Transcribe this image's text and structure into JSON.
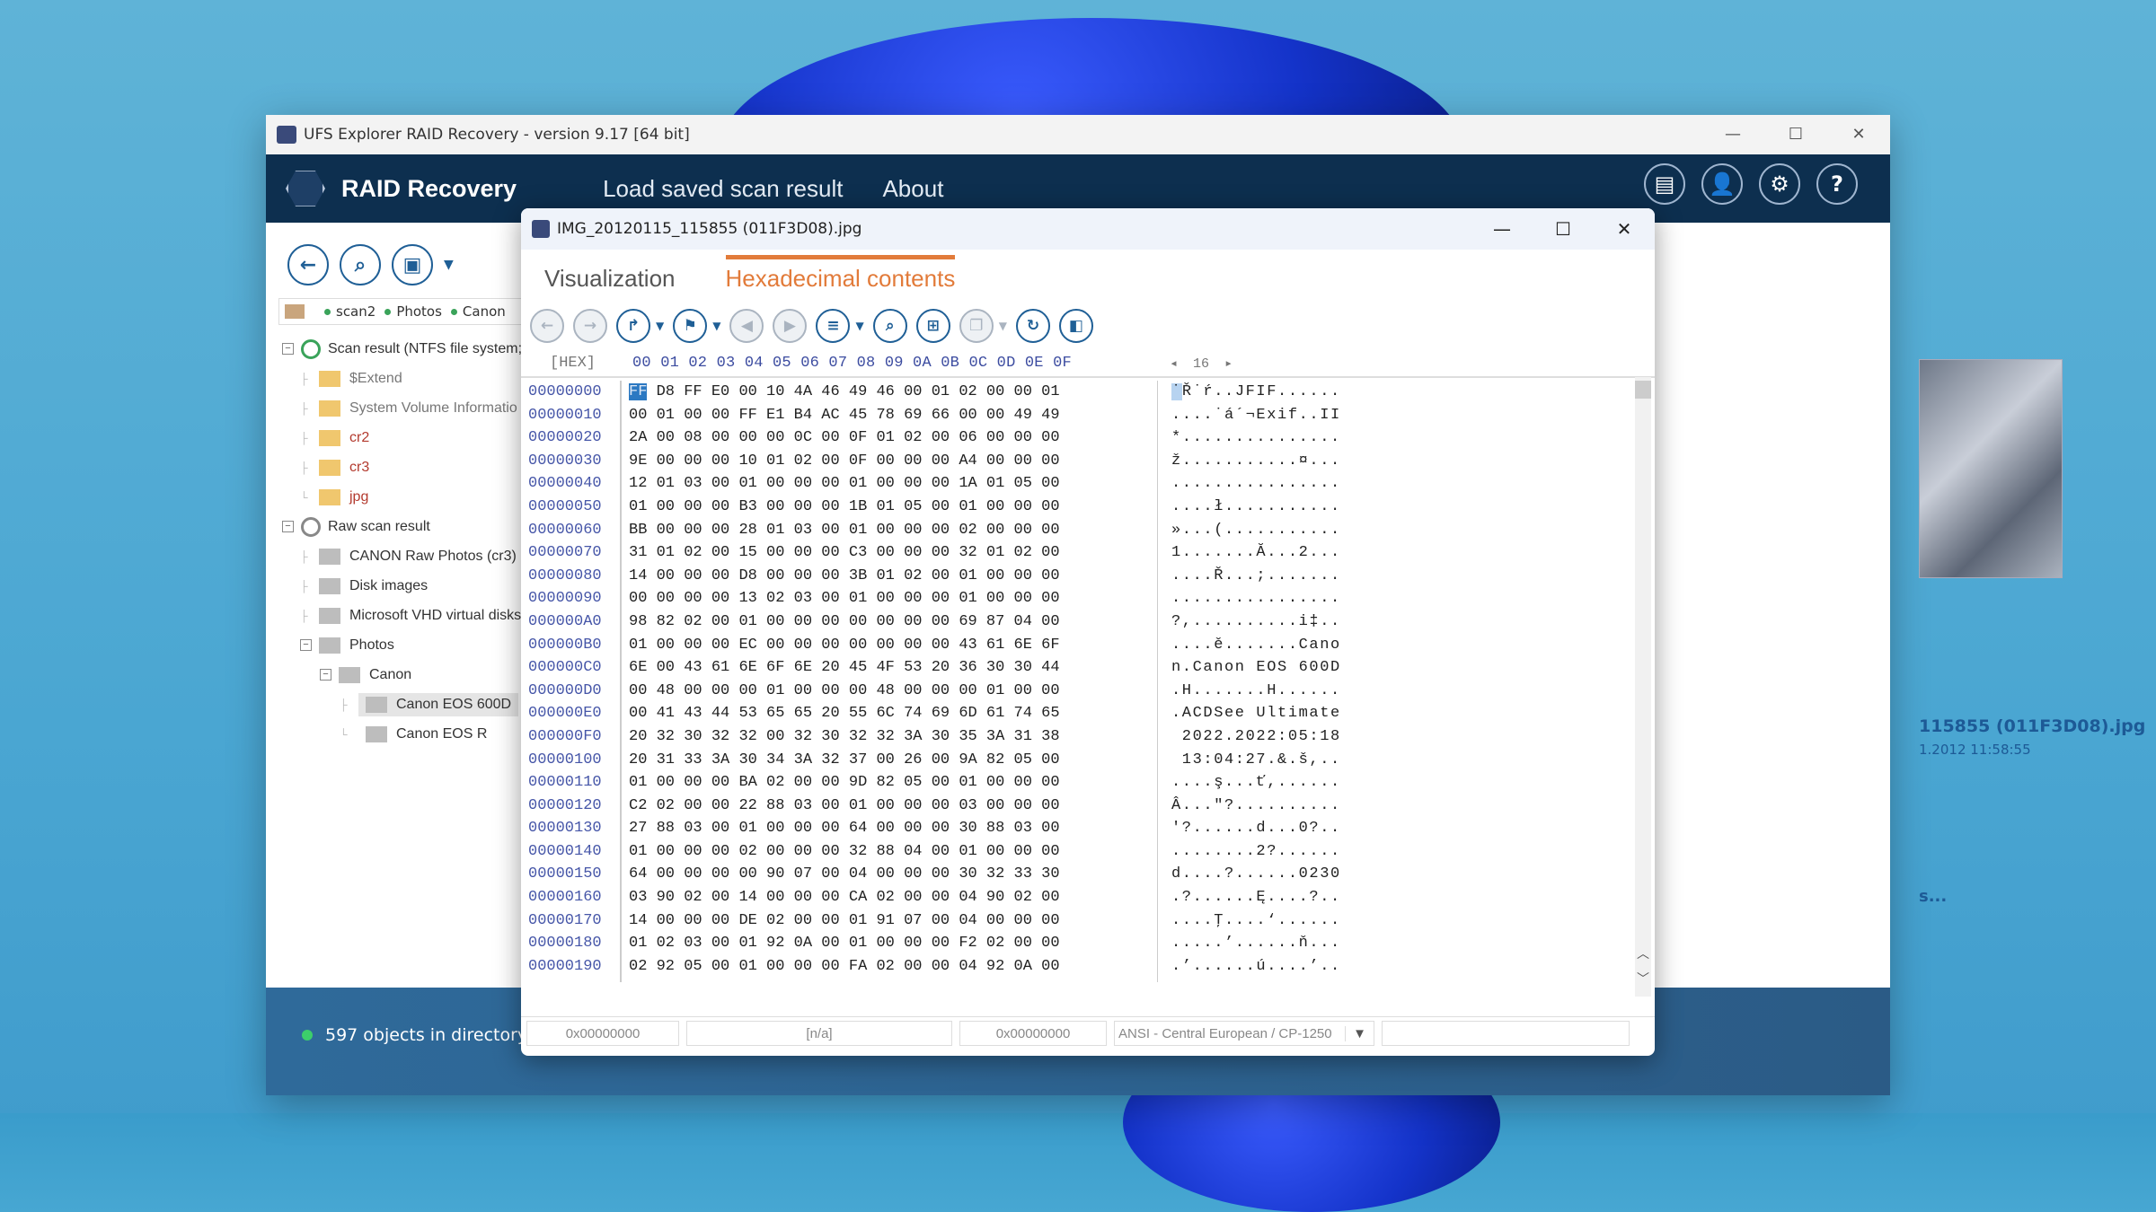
{
  "window": {
    "title": "UFS Explorer RAID Recovery - version 9.17 [64 bit]",
    "controls": {
      "minimize": "—",
      "maximize": "☐",
      "close": "✕"
    }
  },
  "appbar": {
    "brand": "RAID Recovery",
    "menu": [
      "Load saved scan result",
      "About"
    ],
    "icons": [
      {
        "name": "log-icon",
        "glyph": "▤"
      },
      {
        "name": "user-icon",
        "glyph": "👤"
      },
      {
        "name": "gear-icon",
        "glyph": "⚙"
      },
      {
        "name": "help-icon",
        "glyph": "?"
      }
    ]
  },
  "left_toolbar": {
    "icons": [
      {
        "name": "back-icon",
        "glyph": "←"
      },
      {
        "name": "search-icon",
        "glyph": "⌕"
      },
      {
        "name": "save-icon",
        "glyph": "▣"
      }
    ],
    "dropdown": "▼"
  },
  "breadcrumb": [
    "scan2",
    "Photos",
    "Canon"
  ],
  "tree": {
    "scan_result": "Scan result (NTFS file system;",
    "scan_children": [
      {
        "label": "$Extend",
        "style": "gray"
      },
      {
        "label": "System Volume Informatio",
        "style": "gray"
      },
      {
        "label": "cr2",
        "style": "red"
      },
      {
        "label": "cr3",
        "style": "red"
      },
      {
        "label": "jpg",
        "style": "red"
      }
    ],
    "raw_result": "Raw scan result",
    "raw_children": [
      "CANON Raw Photos (cr3)",
      "Disk images",
      "Microsoft VHD virtual disks"
    ],
    "photos": "Photos",
    "canon": "Canon",
    "canon_children": [
      "Canon EOS 600D",
      "Canon EOS R"
    ]
  },
  "preview": {
    "filename": "115855 (011F3D08).jpg",
    "date": "1.2012 11:58:55",
    "more": "s..."
  },
  "status": {
    "text": "597 objects in directory."
  },
  "dialog": {
    "title": "IMG_20120115_115855 (011F3D08).jpg",
    "tabs": [
      {
        "label": "Visualization",
        "active": false
      },
      {
        "label": "Hexadecimal contents",
        "active": true
      }
    ],
    "hex_header": {
      "label": "[HEX]",
      "columns": "00 01 02 03 04 05 06 07 08 09 0A 0B 0C 0D 0E 0F",
      "bytes_per_row": "16",
      "prev": "◂",
      "next": "▸"
    },
    "offsets": [
      "00000000",
      "00000010",
      "00000020",
      "00000030",
      "00000040",
      "00000050",
      "00000060",
      "00000070",
      "00000080",
      "00000090",
      "000000A0",
      "000000B0",
      "000000C0",
      "000000D0",
      "000000E0",
      "000000F0",
      "00000100",
      "00000110",
      "00000120",
      "00000130",
      "00000140",
      "00000150",
      "00000160",
      "00000170",
      "00000180",
      "00000190"
    ],
    "bytes": [
      "FF D8 FF E0 00 10 4A 46 49 46 00 01 02 00 00 01",
      "00 01 00 00 FF E1 B4 AC 45 78 69 66 00 00 49 49",
      "2A 00 08 00 00 00 0C 00 0F 01 02 00 06 00 00 00",
      "9E 00 00 00 10 01 02 00 0F 00 00 00 A4 00 00 00",
      "12 01 03 00 01 00 00 00 01 00 00 00 1A 01 05 00",
      "01 00 00 00 B3 00 00 00 1B 01 05 00 01 00 00 00",
      "BB 00 00 00 28 01 03 00 01 00 00 00 02 00 00 00",
      "31 01 02 00 15 00 00 00 C3 00 00 00 32 01 02 00",
      "14 00 00 00 D8 00 00 00 3B 01 02 00 01 00 00 00",
      "00 00 00 00 13 02 03 00 01 00 00 00 01 00 00 00",
      "98 82 02 00 01 00 00 00 00 00 00 00 69 87 04 00",
      "01 00 00 00 EC 00 00 00 00 00 00 00 43 61 6E 6F",
      "6E 00 43 61 6E 6F 6E 20 45 4F 53 20 36 30 30 44",
      "00 48 00 00 00 01 00 00 00 48 00 00 00 01 00 00",
      "00 41 43 44 53 65 65 20 55 6C 74 69 6D 61 74 65",
      "20 32 30 32 32 00 32 30 32 32 3A 30 35 3A 31 38",
      "20 31 33 3A 30 34 3A 32 37 00 26 00 9A 82 05 00",
      "01 00 00 00 BA 02 00 00 9D 82 05 00 01 00 00 00",
      "C2 02 00 00 22 88 03 00 01 00 00 00 03 00 00 00",
      "27 88 03 00 01 00 00 00 64 00 00 00 30 88 03 00",
      "01 00 00 00 02 00 00 00 32 88 04 00 01 00 00 00",
      "64 00 00 00 00 90 07 00 04 00 00 00 30 32 33 30",
      "03 90 02 00 14 00 00 00 CA 02 00 00 04 90 02 00",
      "14 00 00 00 DE 02 00 00 01 91 07 00 04 00 00 00",
      "01 02 03 00 01 92 0A 00 01 00 00 00 F2 02 00 00",
      "02 92 05 00 01 00 00 00 FA 02 00 00 04 92 0A 00"
    ],
    "ascii": [
      "˙Ř˙ŕ..JFIF......",
      "....˙á´¬Exif..II",
      "*...............",
      "ž...........¤...",
      "................",
      "....ł...........",
      "»...(...........",
      "1.......Ă...2...",
      "....Ř...;.......",
      "................",
      "?,..........i‡..",
      "....ě.......Cano",
      "n.Canon EOS 600D",
      ".H.......H......",
      ".ACDSee Ultimate",
      " 2022.2022:05:18",
      " 13:04:27.&.š,..",
      "....ş...ť,......",
      "Â...\"?..........",
      "'?......d...0?..",
      "........2?......",
      "d....?......0230",
      ".?......Ę....?..",
      "....Ţ....‘......",
      ".....’......ň...",
      ".’......ú....’.."
    ],
    "status_fields": [
      "0x00000000",
      "[n/a]",
      "0x00000000",
      "ANSI - Central European / CP-1250",
      ""
    ],
    "encoding_dropdown": "▼"
  }
}
